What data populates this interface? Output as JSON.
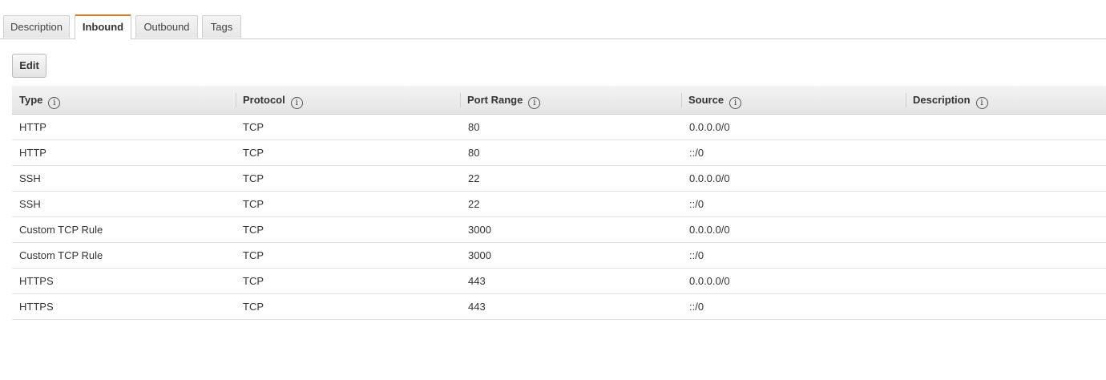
{
  "tabs": [
    {
      "label": "Description",
      "active": false
    },
    {
      "label": "Inbound",
      "active": true
    },
    {
      "label": "Outbound",
      "active": false
    },
    {
      "label": "Tags",
      "active": false
    }
  ],
  "toolbar": {
    "edit_label": "Edit"
  },
  "table": {
    "columns": [
      {
        "label": "Type",
        "icon": "info-icon",
        "icon_glyph": "i"
      },
      {
        "label": "Protocol",
        "icon": "info-icon",
        "icon_glyph": "i"
      },
      {
        "label": "Port Range",
        "icon": "info-icon",
        "icon_glyph": "i"
      },
      {
        "label": "Source",
        "icon": "info-icon",
        "icon_glyph": "i"
      },
      {
        "label": "Description",
        "icon": "info-icon",
        "icon_glyph": "i"
      }
    ],
    "rows": [
      {
        "type": "HTTP",
        "protocol": "TCP",
        "port_range": "80",
        "source": "0.0.0.0/0",
        "description": ""
      },
      {
        "type": "HTTP",
        "protocol": "TCP",
        "port_range": "80",
        "source": "::/0",
        "description": ""
      },
      {
        "type": "SSH",
        "protocol": "TCP",
        "port_range": "22",
        "source": "0.0.0.0/0",
        "description": ""
      },
      {
        "type": "SSH",
        "protocol": "TCP",
        "port_range": "22",
        "source": "::/0",
        "description": ""
      },
      {
        "type": "Custom TCP Rule",
        "protocol": "TCP",
        "port_range": "3000",
        "source": "0.0.0.0/0",
        "description": ""
      },
      {
        "type": "Custom TCP Rule",
        "protocol": "TCP",
        "port_range": "3000",
        "source": "::/0",
        "description": ""
      },
      {
        "type": "HTTPS",
        "protocol": "TCP",
        "port_range": "443",
        "source": "0.0.0.0/0",
        "description": ""
      },
      {
        "type": "HTTPS",
        "protocol": "TCP",
        "port_range": "443",
        "source": "::/0",
        "description": ""
      }
    ]
  },
  "colors": {
    "active_tab_accent": "#e07b1a",
    "header_background": "#e9e9e9",
    "row_divider": "#e0e0e0"
  }
}
